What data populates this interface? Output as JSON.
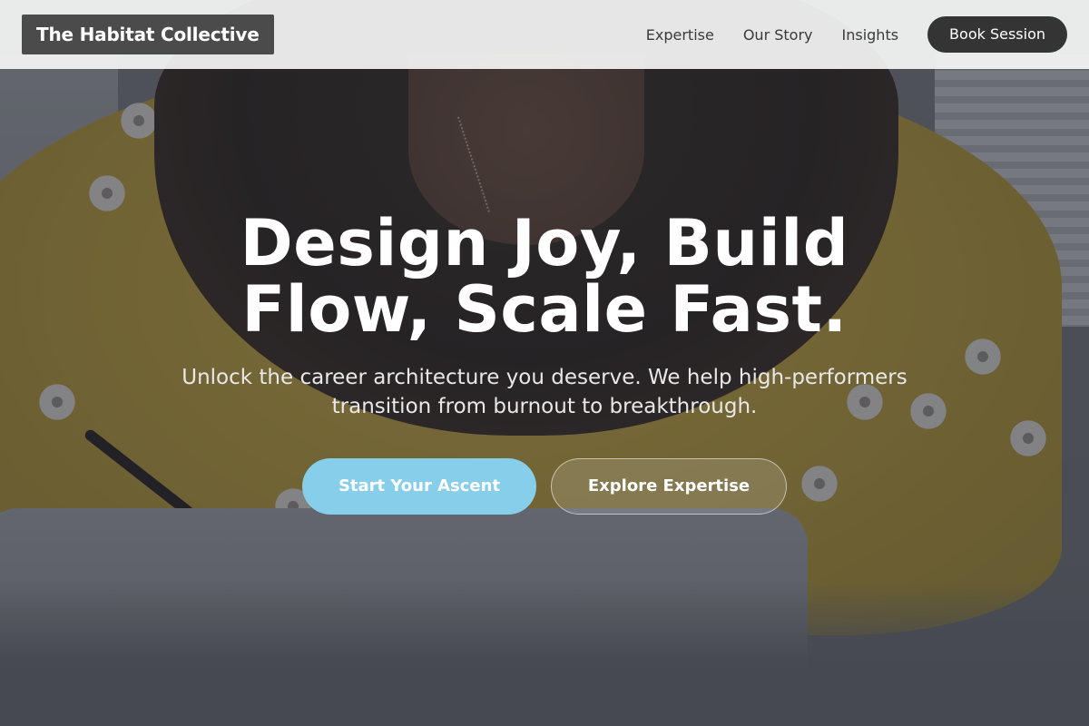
{
  "header": {
    "brand": "The Habitat Collective",
    "nav_links": [
      "Expertise",
      "Our Story",
      "Insights"
    ],
    "book_button": "Book Session"
  },
  "hero": {
    "title_line1": "Design Joy, Build",
    "title_line2": "Flow, Scale Fast.",
    "subtitle_line1": "Unlock the career architecture you deserve. We help high-performers",
    "subtitle_line2": "transition from burnout to breakthrough.",
    "primary_cta": "Start Your Ascent",
    "secondary_cta": "Explore Expertise"
  },
  "colors": {
    "primary_cta": "#87ceeb",
    "book_button": "#343434",
    "brand_bg": "#4b4b4b",
    "header_bg": "#f5f5f5"
  }
}
